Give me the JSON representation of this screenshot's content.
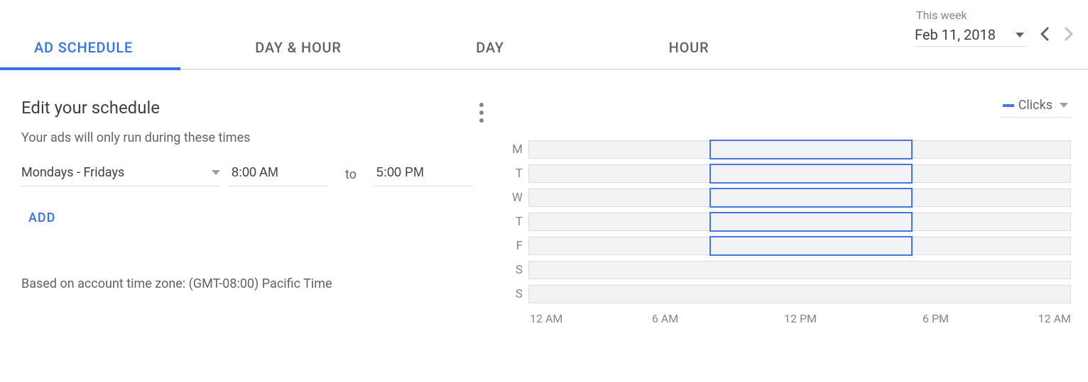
{
  "tabs": [
    {
      "label": "AD SCHEDULE",
      "active": true
    },
    {
      "label": "DAY & HOUR",
      "active": false
    },
    {
      "label": "DAY",
      "active": false
    },
    {
      "label": "HOUR",
      "active": false
    }
  ],
  "date_range": {
    "label": "This week",
    "value": "Feb 11, 2018"
  },
  "panel": {
    "title": "Edit your schedule",
    "subtitle": "Your ads will only run during these times",
    "days_value": "Mondays - Fridays",
    "time_from": "8:00 AM",
    "to_label": "to",
    "time_to": "5:00 PM",
    "add_label": "ADD",
    "timezone_note": "Based on account time zone: (GMT-08:00) Pacific Time"
  },
  "metric": {
    "label": "Clicks",
    "color": "#4775e7"
  },
  "chart_data": {
    "type": "heatmap",
    "title": "Ad schedule",
    "days": [
      "M",
      "T",
      "W",
      "T",
      "F",
      "S",
      "S"
    ],
    "x_ticks": [
      "12 AM",
      "6 AM",
      "12 PM",
      "6 PM",
      "12 AM"
    ],
    "selection": {
      "start_hour": 8,
      "end_hour": 17,
      "day_indices": [
        0,
        1,
        2,
        3,
        4
      ]
    },
    "xlim_hours": [
      0,
      24
    ]
  }
}
